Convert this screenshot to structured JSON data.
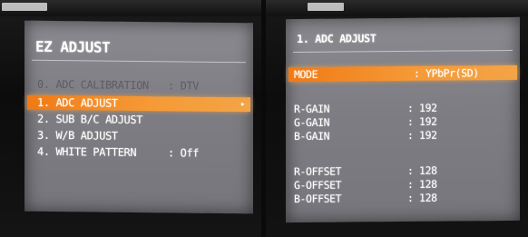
{
  "left_screen": {
    "title": "EZ ADJUST",
    "items": [
      {
        "label": "0. ADC CALIBRATION",
        "value": ": DTV"
      },
      {
        "label": "1. ADC ADJUST",
        "arrow": "▸"
      },
      {
        "label": "2. SUB B/C ADJUST"
      },
      {
        "label": "3. W/B ADJUST"
      },
      {
        "label": "4. WHITE PATTERN",
        "value": ": Off"
      }
    ],
    "selected_index": 1
  },
  "right_screen": {
    "title": "1. ADC ADJUST",
    "mode": {
      "label": "MODE",
      "value": ": YPbPr(SD)"
    },
    "gains": [
      {
        "label": "R-GAIN",
        "value": ": 192"
      },
      {
        "label": "G-GAIN",
        "value": ": 192"
      },
      {
        "label": "B-GAIN",
        "value": ": 192"
      }
    ],
    "offsets": [
      {
        "label": "R-OFFSET",
        "value": ": 128"
      },
      {
        "label": "G-OFFSET",
        "value": ": 128"
      },
      {
        "label": "B-OFFSET",
        "value": ": 128"
      }
    ]
  },
  "colors": {
    "highlight": "#f07a16",
    "osd_background": "#808086",
    "osd_text": "#ffffff",
    "disabled_text": "#5c5c62"
  }
}
